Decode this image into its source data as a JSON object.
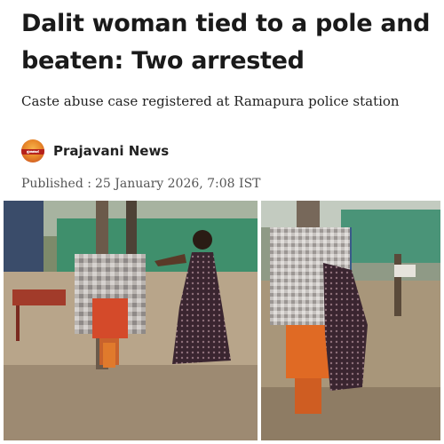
{
  "article": {
    "headline": "Dalit woman tied to a pole and beaten: Two arrested",
    "subheadline": "Caste abuse case registered at Ramapura police station",
    "publisher": "Prajavani News",
    "logo_text": "ಪ್ರಜಾವಾಣಿ",
    "published_label": "Published :",
    "published_date": "25 January 2026, 7:08 IST"
  },
  "media": {
    "icon": "news-photo",
    "panels": 2
  },
  "colors": {
    "headline": "#1a1a1a",
    "meta": "#555555",
    "logo": "#e8892a"
  }
}
